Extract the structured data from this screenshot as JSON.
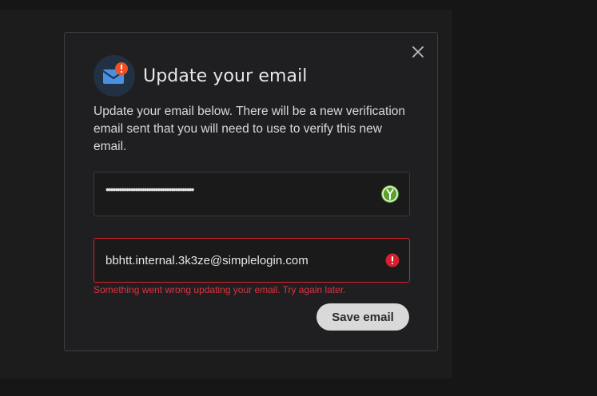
{
  "modal": {
    "title": "Update your email",
    "description": "Update your email below. There will be a new verification email sent that you will need to use to verify this new email.",
    "password_field": {
      "value": "•••••••••••••••••••••••••••••••••••••••"
    },
    "email_field": {
      "value": "bbhtt.internal.3k3ze@simplelogin.com"
    },
    "error_message": "Something went wrong updating your email. Try again later.",
    "save_label": "Save email"
  },
  "colors": {
    "error": "#d5202e",
    "accent_icon": "#4a90e2",
    "warning_badge": "#f04e23",
    "keeper_green": "#5aa02c"
  },
  "icons": {
    "header": "mail-alert-icon",
    "close": "close-icon",
    "password_manager": "keeper-icon",
    "error": "error-icon"
  }
}
